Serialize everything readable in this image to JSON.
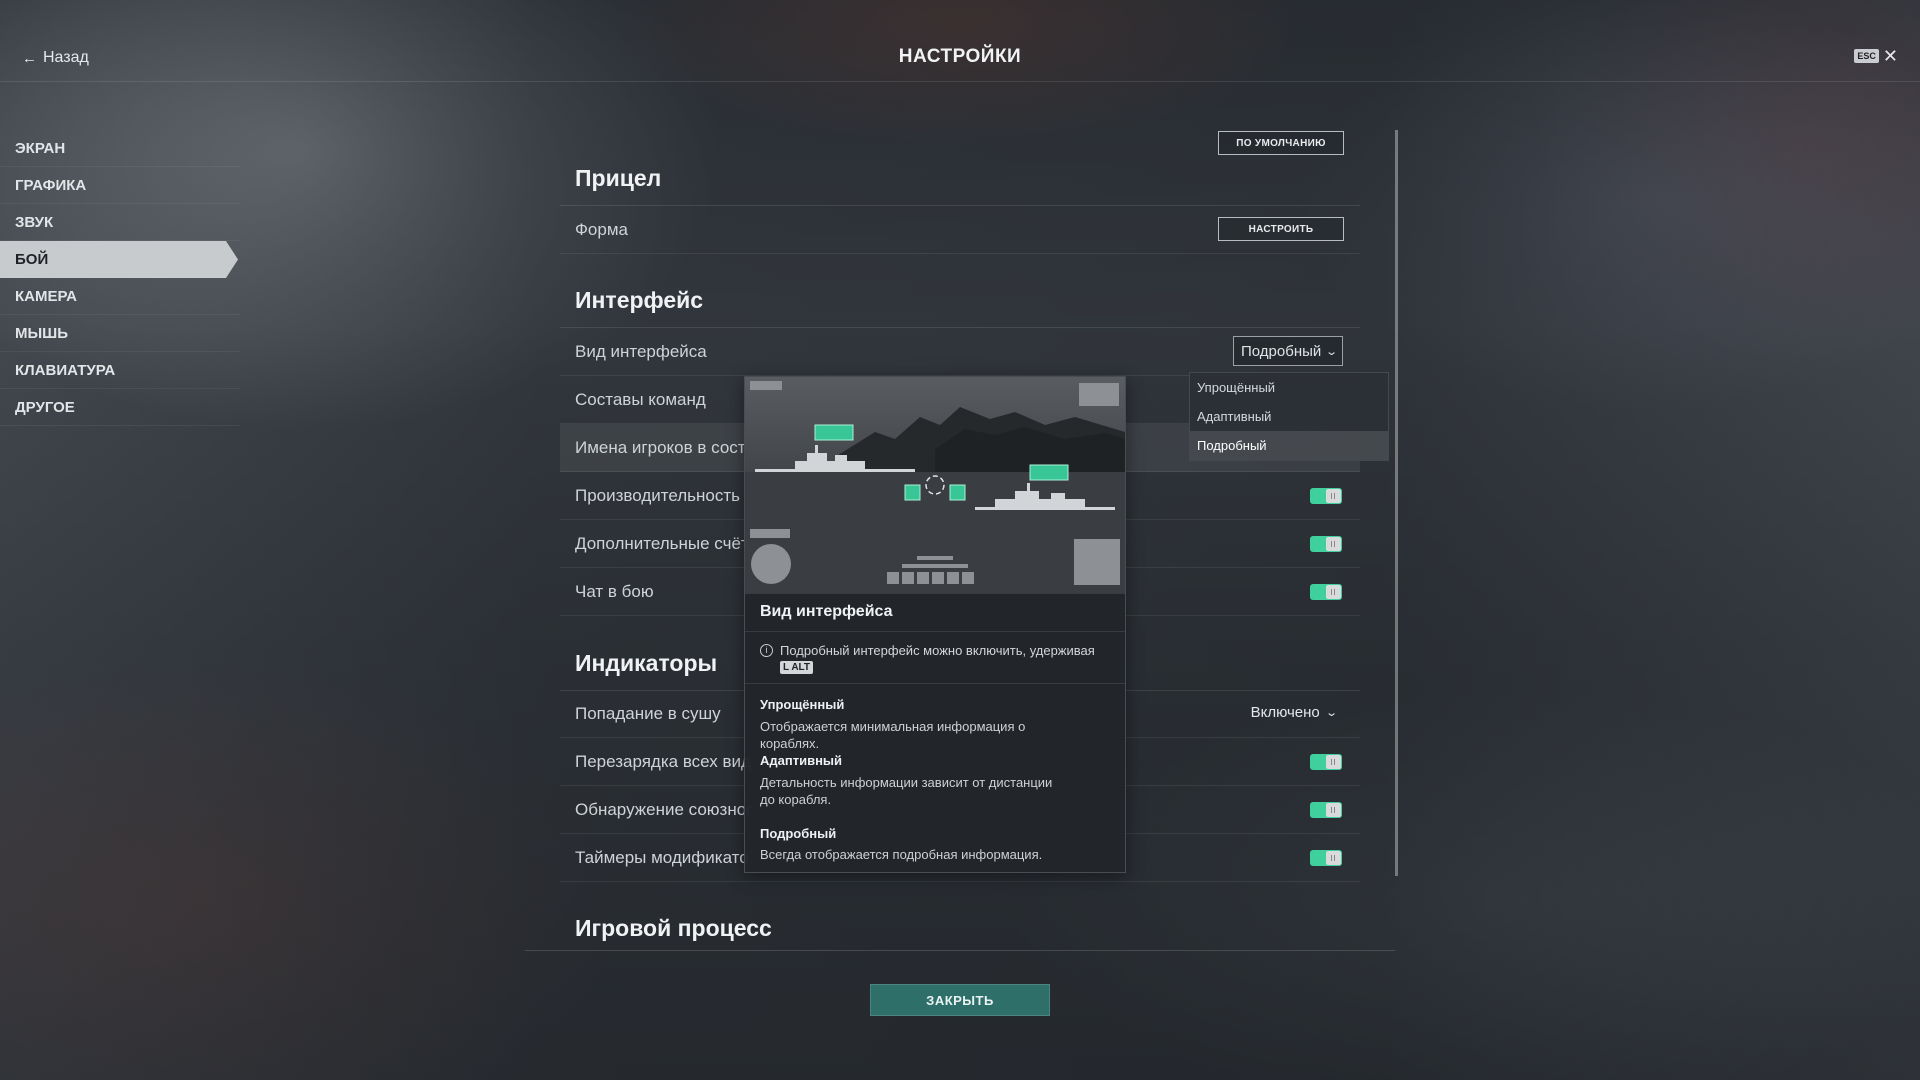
{
  "header": {
    "back_label": "Назад",
    "title": "НАСТРОЙКИ",
    "esc_key": "ESC",
    "close_glyph": "✕"
  },
  "sidebar": {
    "items": [
      {
        "label": "ЭКРАН",
        "active": false
      },
      {
        "label": "ГРАФИКА",
        "active": false
      },
      {
        "label": "ЗВУК",
        "active": false
      },
      {
        "label": "БОЙ",
        "active": true
      },
      {
        "label": "КАМЕРА",
        "active": false
      },
      {
        "label": "МЫШЬ",
        "active": false
      },
      {
        "label": "КЛАВИАТУРА",
        "active": false
      },
      {
        "label": "ДРУГОЕ",
        "active": false
      }
    ]
  },
  "main": {
    "default_button": "ПО УМОЛЧАНИЮ",
    "sections": {
      "aim": {
        "title": "Прицел",
        "form_label": "Форма",
        "configure_button": "НАСТРОИТЬ"
      },
      "interface": {
        "title": "Интерфейс",
        "view_label": "Вид интерфейса",
        "view_value": "Подробный",
        "teams_label": "Составы команд",
        "player_names_label": "Имена игроков в соста",
        "performance_label": "Производительность",
        "performance_on": true,
        "extra_counters_label": "Дополнительные счётч",
        "extra_counters_on": true,
        "chat_label": "Чат в бою",
        "chat_on": true
      },
      "indicators": {
        "title": "Индикаторы",
        "land_hit_label": "Попадание в сушу",
        "land_hit_value": "Включено",
        "reload_label": "Перезарядка всех вид",
        "reload_on": true,
        "ally_detect_label": "Обнаружение союзног",
        "ally_detect_on": true,
        "modifier_timers_label": "Таймеры модификато",
        "modifier_timers_on": true
      },
      "gameplay": {
        "title": "Игровой процесс"
      }
    }
  },
  "dropdown": {
    "options": [
      "Упрощённый",
      "Адаптивный",
      "Подробный"
    ],
    "selected": "Подробный"
  },
  "tooltip": {
    "title": "Вид интерфейса",
    "info_text": "Подробный интерфейс можно включить, удерживая",
    "info_key": "L ALT",
    "options": [
      {
        "name": "Упрощённый",
        "desc": "Отображается минимальная информация о кораблях."
      },
      {
        "name": "Адаптивный",
        "desc": "Детальность информации зависит от дистанции до корабля."
      },
      {
        "name": "Подробный",
        "desc": "Всегда отображается подробная информация."
      }
    ]
  },
  "footer": {
    "close_button": "ЗАКРЫТЬ"
  },
  "colors": {
    "accent_toggle": "#3fd09e",
    "close_button": "#2f6f6a",
    "preview_marker": "#39c697"
  }
}
